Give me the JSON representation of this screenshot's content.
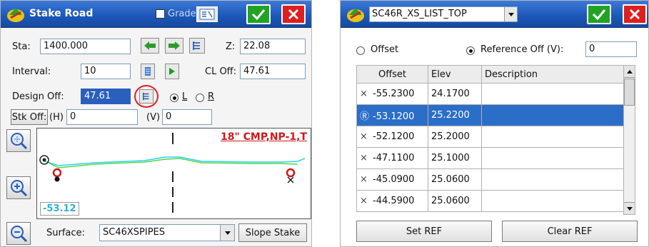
{
  "left": {
    "title": "Stake Road",
    "grade_label": "Grade",
    "sta_label": "Sta:",
    "sta_value": "1400.000",
    "z_label": "Z:",
    "z_value": "22.08",
    "interval_label": "Interval:",
    "interval_value": "10",
    "cl_off_label": "CL Off:",
    "cl_off_value": "47.61",
    "design_off_label": "Design Off:",
    "design_off_value": "47.61",
    "l_label": "L",
    "r_label": "R",
    "stk_off_label": "Stk Off:",
    "h_label": "(H)",
    "h_value": "0",
    "v_label": "(V)",
    "v_value": "0",
    "feature_label": "18\" CMP,NP-1,T",
    "offset_readout": "-53.12",
    "surface_label": "Surface:",
    "surface_value": "SC46XSPIPES",
    "slope_stake_label": "Slope Stake"
  },
  "right": {
    "title_select": "SC46R_XS_LIST_TOP",
    "offset_radio": "Offset",
    "reference_off_label": "Reference Off (V):",
    "reference_off_value": "0",
    "columns": [
      "Offset",
      "Elev",
      "Description"
    ],
    "rows": [
      {
        "mark": "×",
        "offset": "-55.2300",
        "elev": "24.1700",
        "desc": ""
      },
      {
        "mark": "Ⓡ",
        "offset": "-53.1200",
        "elev": "25.2200",
        "desc": ""
      },
      {
        "mark": "×",
        "offset": "-52.1200",
        "elev": "25.2000",
        "desc": ""
      },
      {
        "mark": "×",
        "offset": "-47.1100",
        "elev": "25.1000",
        "desc": ""
      },
      {
        "mark": "×",
        "offset": "-45.0900",
        "elev": "25.0600",
        "desc": ""
      },
      {
        "mark": "×",
        "offset": "-44.5900",
        "elev": "25.0600",
        "desc": ""
      }
    ],
    "set_ref_label": "Set REF",
    "clear_ref_label": "Clear REF"
  },
  "colors": {
    "title_blue": "#1c56b7",
    "ok_green": "#22a326",
    "cancel_red": "#de1f1f",
    "selection_blue": "#2b6ec8",
    "feature_red": "#d01818",
    "profile_cyan": "#2fd0e8",
    "profile_green": "#4cd84c"
  }
}
